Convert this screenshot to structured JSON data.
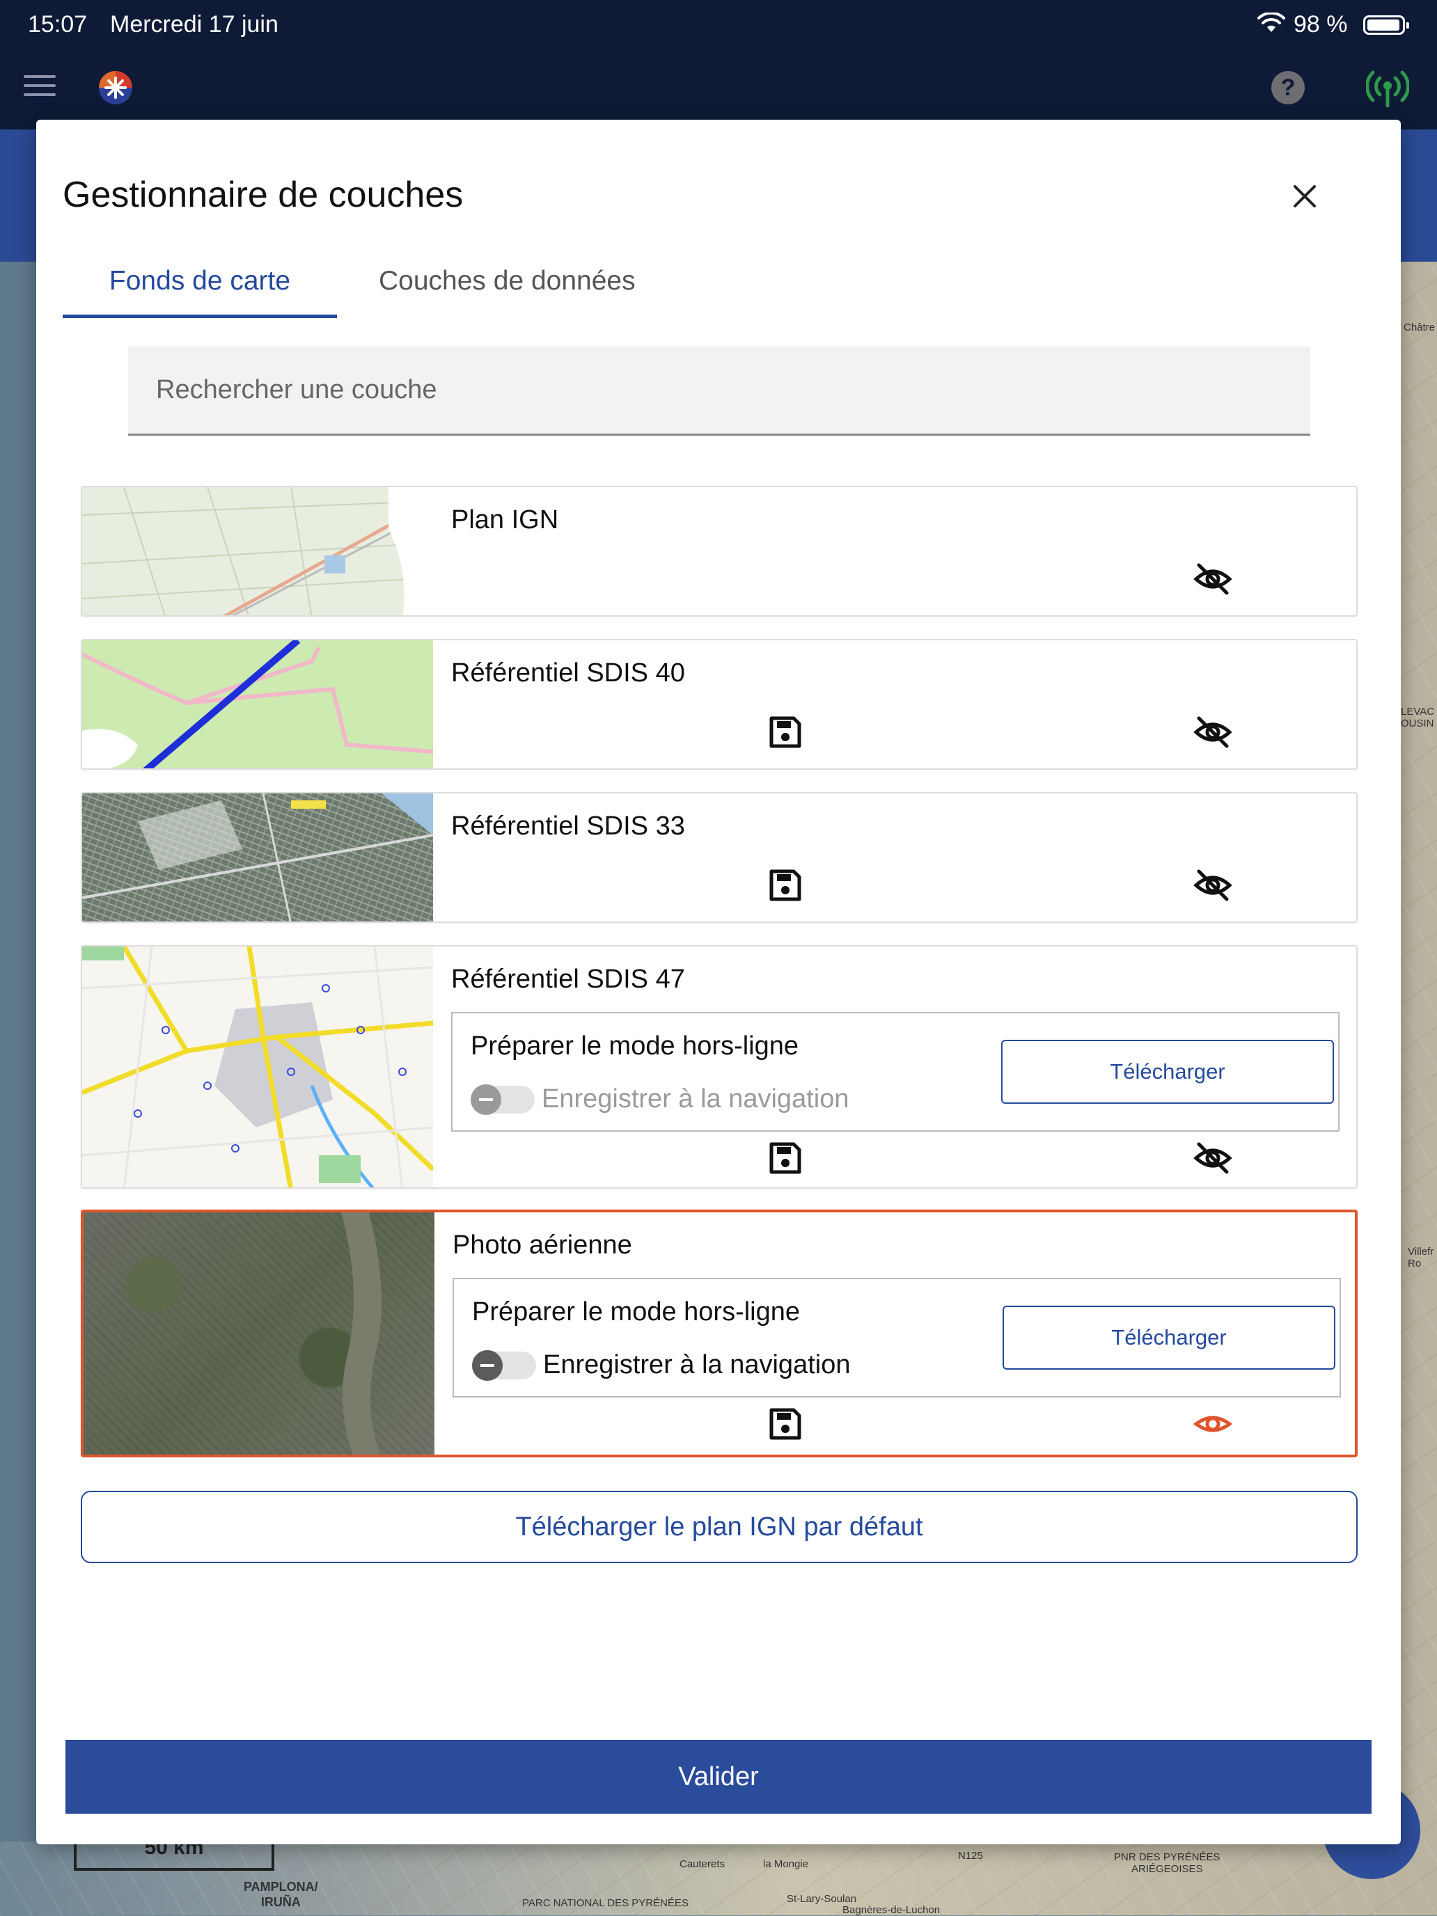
{
  "status_bar": {
    "time": "15:07",
    "date": "Mercredi 17 juin",
    "battery_percent": "98 %"
  },
  "map": {
    "scale_label": "50 km",
    "labels": [
      "Châtre",
      "LEVAC\nOUSIN",
      "Villefr\nRo",
      "Cauterets",
      "la Mongie",
      "St-Lary-Soulan",
      "Bagnères-de-Luchon",
      "PARC NATIONAL DES PYRÉNÉES",
      "PNR DES PYRÉNÉES\nARIÉGEOISES",
      "N125"
    ],
    "town": "PAMPLONA/\nIRUÑA"
  },
  "dialog": {
    "title": "Gestionnaire de couches",
    "tabs": [
      {
        "label": "Fonds de carte",
        "active": true
      },
      {
        "label": "Couches de données",
        "active": false
      }
    ],
    "search_placeholder": "Rechercher une couche",
    "layers": [
      {
        "name": "Plan IGN",
        "has_save": false,
        "visible": false,
        "selected": false,
        "offline_panel": false
      },
      {
        "name": "Référentiel SDIS 40",
        "has_save": true,
        "visible": false,
        "selected": false,
        "offline_panel": false
      },
      {
        "name": "Référentiel SDIS 33",
        "has_save": true,
        "visible": false,
        "selected": false,
        "offline_panel": false
      },
      {
        "name": "Référentiel SDIS 47",
        "has_save": true,
        "visible": false,
        "selected": false,
        "offline_panel": true,
        "offline": {
          "title": "Préparer le mode hors-ligne",
          "toggle_label": "Enregistrer à la navigation",
          "toggle_enabled": false,
          "download_label": "Télécharger"
        }
      },
      {
        "name": "Photo aérienne",
        "has_save": true,
        "visible": true,
        "selected": true,
        "offline_panel": true,
        "offline": {
          "title": "Préparer le mode hors-ligne",
          "toggle_label": "Enregistrer à la navigation",
          "toggle_enabled": true,
          "download_label": "Télécharger"
        }
      }
    ],
    "default_download_label": "Télécharger le plan IGN par défaut",
    "validate_label": "Valider"
  },
  "colors": {
    "primary": "#2b4b9b",
    "accent_selected": "#e0552b",
    "app_bar": "#0e1a36",
    "signal_green": "#2e9a4a"
  },
  "icons": {
    "menu": "hamburger-icon",
    "logo": "app-logo",
    "help": "help-icon",
    "signal": "antenna-icon",
    "close": "close-icon",
    "save": "save-icon",
    "visibility_off": "eye-off-icon",
    "visibility_on": "eye-icon"
  }
}
